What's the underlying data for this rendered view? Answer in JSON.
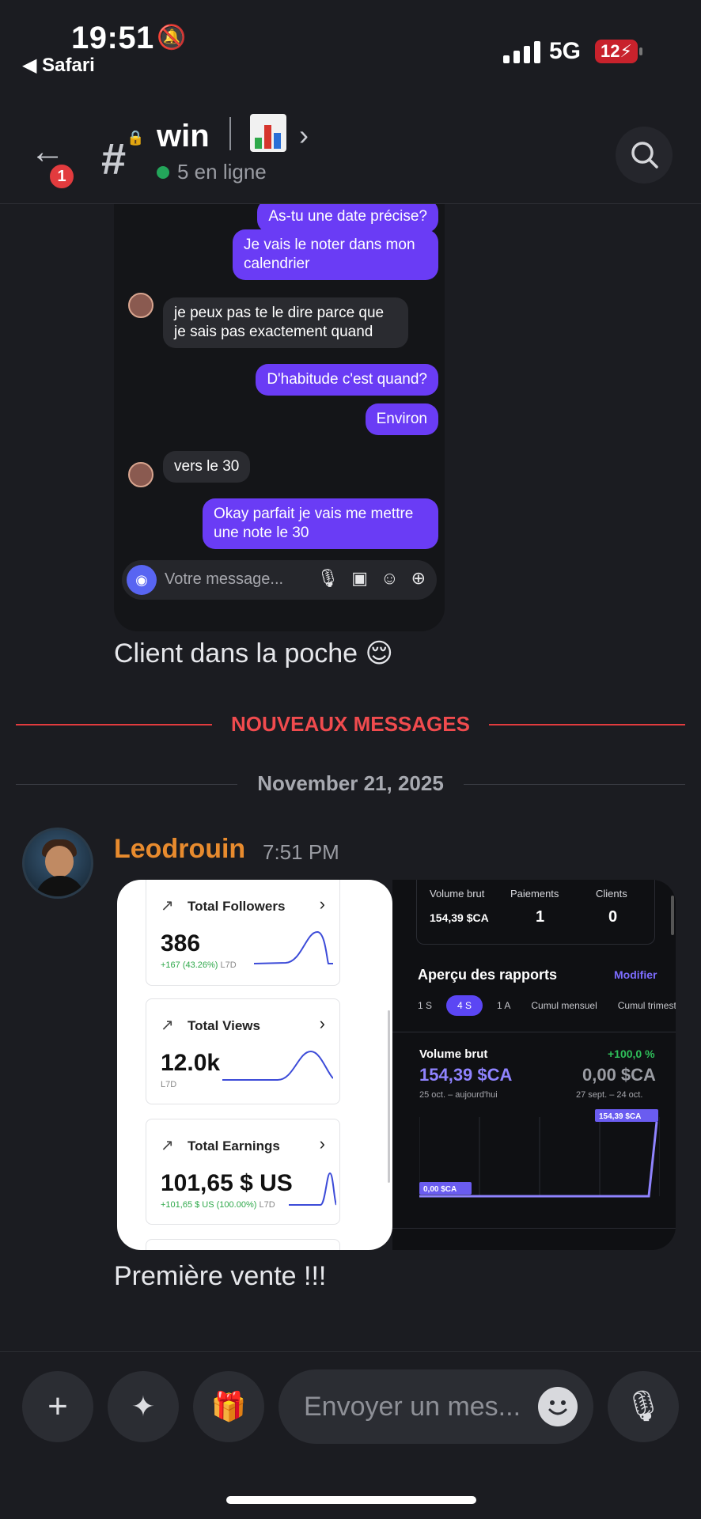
{
  "status": {
    "time": "19:51",
    "back_app": "◀ Safari",
    "network": "5G",
    "battery": "12"
  },
  "header": {
    "badge": "1",
    "channel": "win",
    "online": "5 en ligne"
  },
  "chat_screenshot": {
    "messages": [
      {
        "side": "right",
        "text": "As-tu une date précise?"
      },
      {
        "side": "right",
        "text": "Je vais le noter dans mon calendrier"
      },
      {
        "side": "left",
        "text": "je peux pas te le dire parce que je sais pas exactement quand"
      },
      {
        "side": "right",
        "text": "D'habitude c'est quand?"
      },
      {
        "side": "right",
        "text": "Environ"
      },
      {
        "side": "left",
        "text": "vers le 30"
      },
      {
        "side": "right",
        "text": "Okay parfait je vais me mettre une note le 30"
      }
    ],
    "composer_placeholder": "Votre message..."
  },
  "message1": {
    "text": "Client dans la poche 😌"
  },
  "dividers": {
    "new_messages": "NOUVEAUX MESSAGES",
    "date": "November 21, 2025"
  },
  "message2": {
    "author": "Leodrouin",
    "time": "7:51 PM",
    "text": "Première vente !!!"
  },
  "analytics": {
    "cards": [
      {
        "title": "Total Followers",
        "value": "386",
        "delta": "+167 (43.26%)",
        "period": "L7D"
      },
      {
        "title": "Total Views",
        "value": "12.0k",
        "delta": "",
        "period": "L7D"
      },
      {
        "title": "Total Earnings",
        "value": "101,65 $ US",
        "delta": "+101,65 $ US (100.00%)",
        "period": "L7D"
      }
    ]
  },
  "payments": {
    "stats": {
      "gross_label": "Volume brut",
      "gross_value": "154,39 $CA",
      "payments_label": "Paiements",
      "payments_value": "1",
      "clients_label": "Clients",
      "clients_value": "0"
    },
    "reports_title": "Aperçu des rapports",
    "edit": "Modifier",
    "tabs": [
      "1 S",
      "4 S",
      "1 A",
      "Cumul mensuel",
      "Cumul trimestrie"
    ],
    "active_tab": "4 S",
    "metric": "Volume brut",
    "change": "+100,0 %",
    "current": "154,39 $CA",
    "previous": "0,00 $CA",
    "period_current": "25 oct. – aujourd'hui",
    "period_previous": "27 sept. – 24 oct.",
    "chart_data": {
      "type": "line",
      "x": [
        "25 oct.",
        "aujourd'hui"
      ],
      "series": [
        {
          "values": [
            0,
            0,
            0,
            0,
            0,
            154.39
          ]
        }
      ],
      "annotations": [
        "0,00 $CA",
        "154,39 $CA"
      ]
    }
  },
  "bottom": {
    "placeholder": "Envoyer un mes..."
  }
}
